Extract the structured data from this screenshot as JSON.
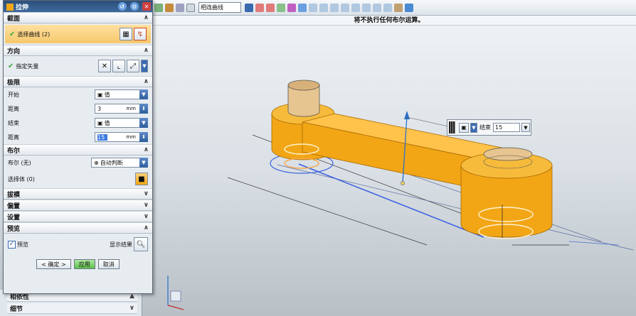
{
  "dialog": {
    "title": "拉伸",
    "sections": {
      "section_label": "截面",
      "direction_label": "方向",
      "limits_label": "极限",
      "boolean_label": "布尔",
      "draft_label": "拔模",
      "offset_label": "偏置",
      "settings_label": "设置",
      "preview_label": "预览"
    },
    "select_curve": "选择曲线 (2)",
    "specify_vector": "指定矢量",
    "start_label": "开始",
    "start_value": "值",
    "start_distance_label": "距离",
    "start_distance": "3",
    "end_label": "结束",
    "end_value": "值",
    "end_distance_label": "距离",
    "end_distance": "15",
    "unit": "mm",
    "boolean_none": "布尔 (无)",
    "boolean_value": "自动判断",
    "select_body": "选择体 (0)",
    "preview_checkbox": "预览",
    "show_result": "显示结果",
    "ok_button": "< 确定 >",
    "apply_button": "应用",
    "cancel_button": "取消"
  },
  "tree": {
    "row1": "相依性",
    "row2": "细节"
  },
  "toolbar": {
    "filter": "相连曲线"
  },
  "status": "将不执行任何布尔运算。",
  "tag": {
    "label": "结束",
    "value": "15"
  },
  "colors": {
    "part_body": "#f2a616",
    "part_edge": "#a86a00",
    "hole_inner": "#e0b160",
    "selected_curve": "#3a5fe0",
    "dialog_title": "#2b4f7a"
  }
}
